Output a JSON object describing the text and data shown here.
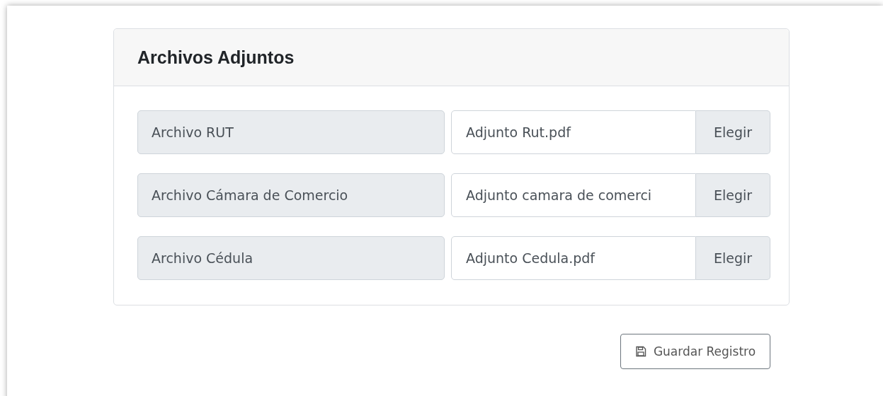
{
  "card": {
    "title": "Archivos Adjuntos",
    "rows": [
      {
        "label": "Archivo RUT",
        "value": "Adjunto Rut.pdf",
        "button": "Elegir"
      },
      {
        "label": "Archivo Cámara de Comercio",
        "value": "Adjunto camara de comerci",
        "button": "Elegir"
      },
      {
        "label": "Archivo Cédula",
        "value": "Adjunto Cedula.pdf",
        "button": "Elegir"
      }
    ]
  },
  "save_button": {
    "label": "Guardar Registro"
  }
}
